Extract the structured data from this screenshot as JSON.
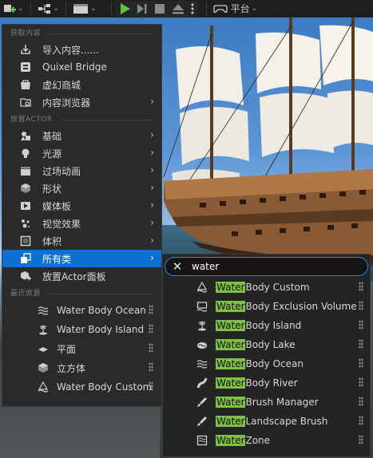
{
  "toolbar": {
    "platform_label": "平台"
  },
  "menu": {
    "section_get_content": "获取内容",
    "get_content_items": [
      {
        "label": "导入内容......",
        "icon": "import-icon"
      },
      {
        "label": "Quixel Bridge",
        "icon": "bridge-icon"
      },
      {
        "label": "虚幻商城",
        "icon": "marketplace-icon"
      },
      {
        "label": "内容浏览器",
        "icon": "content-browser-icon"
      }
    ],
    "section_place_actor": "放置ACTOR",
    "place_items": [
      {
        "label": "基础",
        "icon": "basic-icon"
      },
      {
        "label": "光源",
        "icon": "light-icon"
      },
      {
        "label": "过场动画",
        "icon": "cinematic-icon"
      },
      {
        "label": "形状",
        "icon": "shape-icon"
      },
      {
        "label": "媒体板",
        "icon": "media-icon"
      },
      {
        "label": "视觉效果",
        "icon": "visual-effects-icon"
      },
      {
        "label": "体积",
        "icon": "volume-icon"
      },
      {
        "label": "所有类",
        "icon": "all-classes-icon"
      },
      {
        "label": "放置Actor面板",
        "icon": "place-actor-panel-icon"
      }
    ],
    "section_recent": "最近放置",
    "recent_items": [
      {
        "label": "Water Body Ocean",
        "icon": "water-ocean-icon"
      },
      {
        "label": "Water Body Island",
        "icon": "water-island-icon"
      },
      {
        "label": "平面",
        "icon": "plane-icon"
      },
      {
        "label": "立方体",
        "icon": "cube-icon"
      },
      {
        "label": "Water Body Custom",
        "icon": "water-custom-icon"
      }
    ]
  },
  "submenu": {
    "search_value": "water",
    "results": [
      {
        "highlight": "Water",
        "rest": " Body Custom",
        "icon": "water-custom-icon"
      },
      {
        "highlight": "Water",
        "rest": " Body Exclusion Volume",
        "icon": "exclusion-volume-icon"
      },
      {
        "highlight": "Water",
        "rest": " Body Island",
        "icon": "water-island-icon"
      },
      {
        "highlight": "Water",
        "rest": " Body Lake",
        "icon": "water-lake-icon"
      },
      {
        "highlight": "Water",
        "rest": " Body Ocean",
        "icon": "water-ocean-icon"
      },
      {
        "highlight": "Water",
        "rest": " Body River",
        "icon": "water-river-icon"
      },
      {
        "highlight": "Water",
        "rest": " Brush Manager",
        "icon": "brush-manager-icon"
      },
      {
        "highlight": "Water",
        "rest": " Landscape Brush",
        "icon": "landscape-brush-icon"
      },
      {
        "highlight": "Water",
        "rest": " Zone",
        "icon": "water-zone-icon"
      }
    ]
  }
}
